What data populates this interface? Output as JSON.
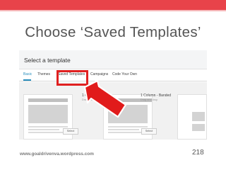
{
  "slide": {
    "title": "Choose ‘Saved Templates’",
    "footer_url": "www.goaldrivenva.wordpress.com",
    "page_number": "218",
    "accent_color": "#e8434a"
  },
  "app": {
    "heading": "Select a template",
    "tabs": [
      {
        "label": "Basic",
        "active": true
      },
      {
        "label": "Themes",
        "active": false
      },
      {
        "label": "Saved Templates",
        "active": false,
        "highlighted": true
      },
      {
        "label": "Campaigns",
        "active": false
      },
      {
        "label": "Code Your Own",
        "active": false
      }
    ],
    "templates": [
      {
        "name": "1 Column",
        "subtitle": "Drag and drop",
        "button": "Select",
        "icon": "single-column-layout-icon"
      },
      {
        "name": "1 Column - Banded",
        "subtitle": "Drag and drop",
        "button": "Select",
        "icon": "banded-column-layout-icon"
      }
    ]
  },
  "annotation": {
    "arrow_icon": "red-arrow-icon",
    "highlight_color": "#e02020"
  }
}
